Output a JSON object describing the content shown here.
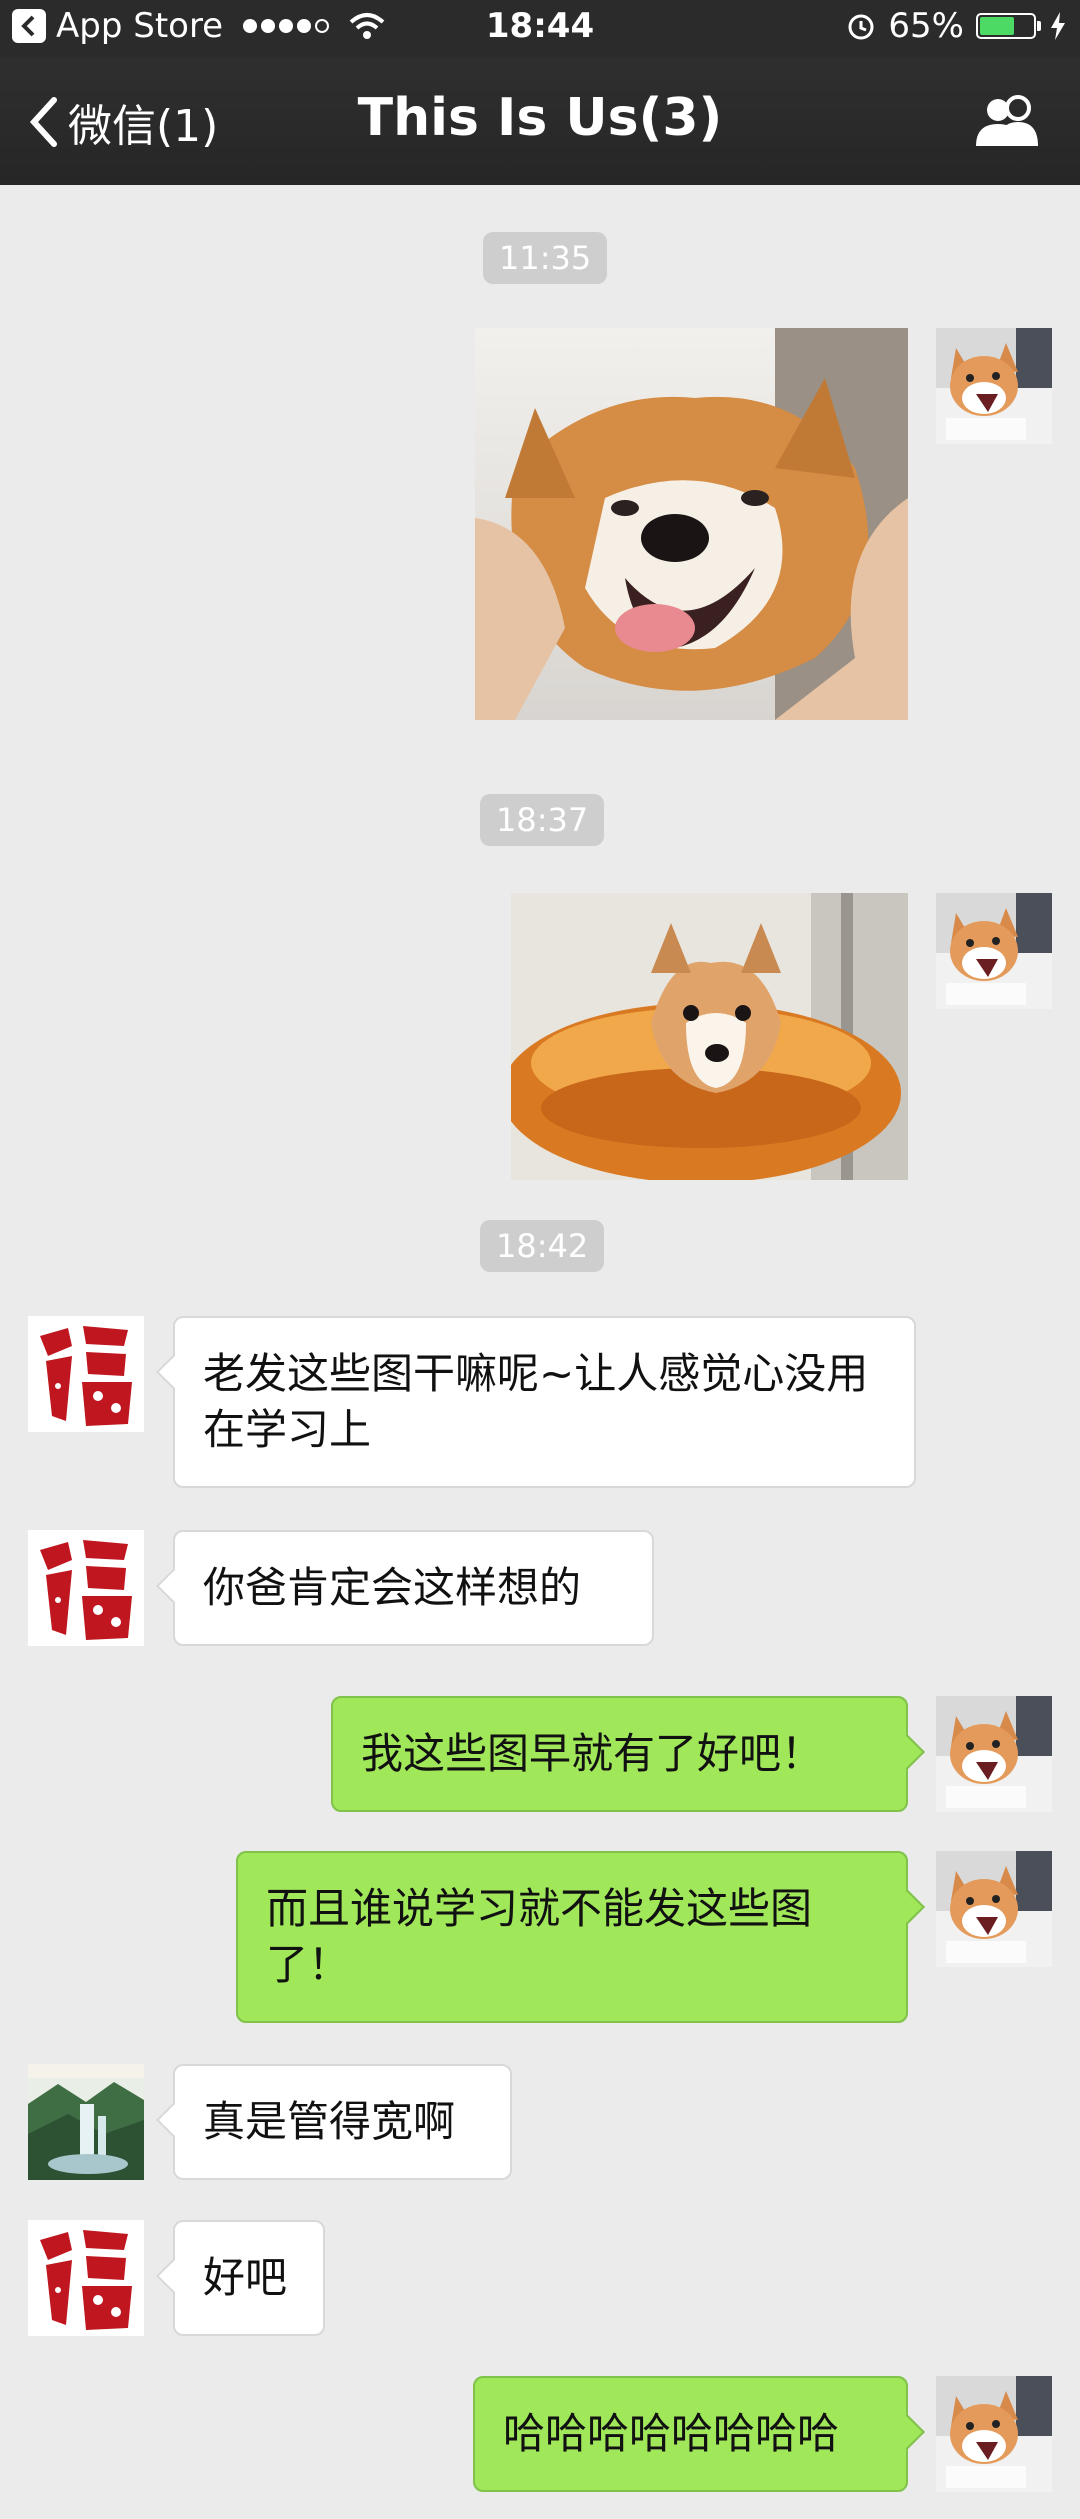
{
  "status_bar": {
    "carrier": "App Store",
    "time": "18:44",
    "battery_percent": "65%",
    "battery_level": 0.65
  },
  "nav": {
    "back_label": "微信(1)",
    "title": "This Is Us(3)"
  },
  "chat": {
    "timestamps": [
      "11:35",
      "18:37",
      "18:42"
    ],
    "messages": [
      "老发这些图干嘛呢~让人感觉心没用在学习上",
      "你爸肯定会这样想的",
      "我这些图早就有了好吧！",
      "而且谁说学习就不能发这些图了！",
      "真是管得宽啊",
      "好吧",
      "哈哈哈哈哈哈哈哈"
    ]
  },
  "colors": {
    "outgoing_bubble": "#a0e75a",
    "incoming_bubble": "#ffffff",
    "background": "#ebebeb",
    "nav_bar": "#2b2b2b"
  }
}
